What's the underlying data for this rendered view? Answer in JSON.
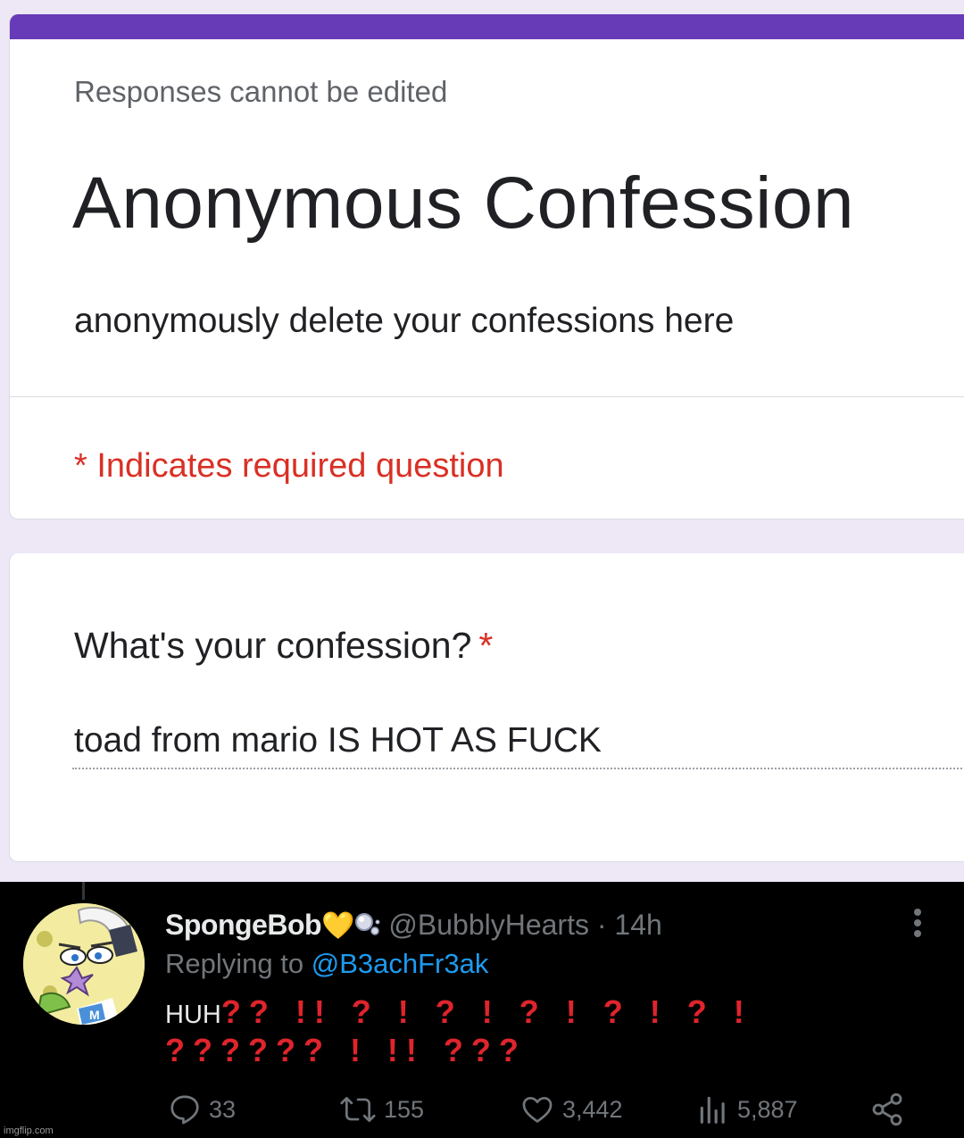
{
  "form": {
    "accent_color": "#673ab7",
    "note": "Responses cannot be edited",
    "title": "Anonymous Confession",
    "description": "anonymously delete your confessions here",
    "required_notice": "* Indicates required question",
    "question": {
      "label": "What's your confession?",
      "required_mark": "*",
      "answer": "toad from mario IS HOT AS FUCK"
    }
  },
  "tweet": {
    "display_name": "SpongeBob",
    "name_emoji_heart": "💛",
    "handle": "@BubblyHearts",
    "separator": "·",
    "time": "14h",
    "replying_prefix": "Replying to",
    "replying_to": "@B3achFr3ak",
    "text_start": "HUH",
    "text_marks": "?? !! ? ! ? ! ? ! ? ! ? ! ?????? ! !! ???",
    "stats": {
      "replies": "33",
      "retweets": "155",
      "likes": "3,442",
      "views": "5,887"
    },
    "icons": [
      "reply-icon",
      "retweet-icon",
      "like-icon",
      "views-icon",
      "share-icon",
      "more-icon"
    ],
    "accent_color": "#1d9bf0",
    "marks_color": "#e0242c"
  },
  "watermark": "imgflip.com"
}
